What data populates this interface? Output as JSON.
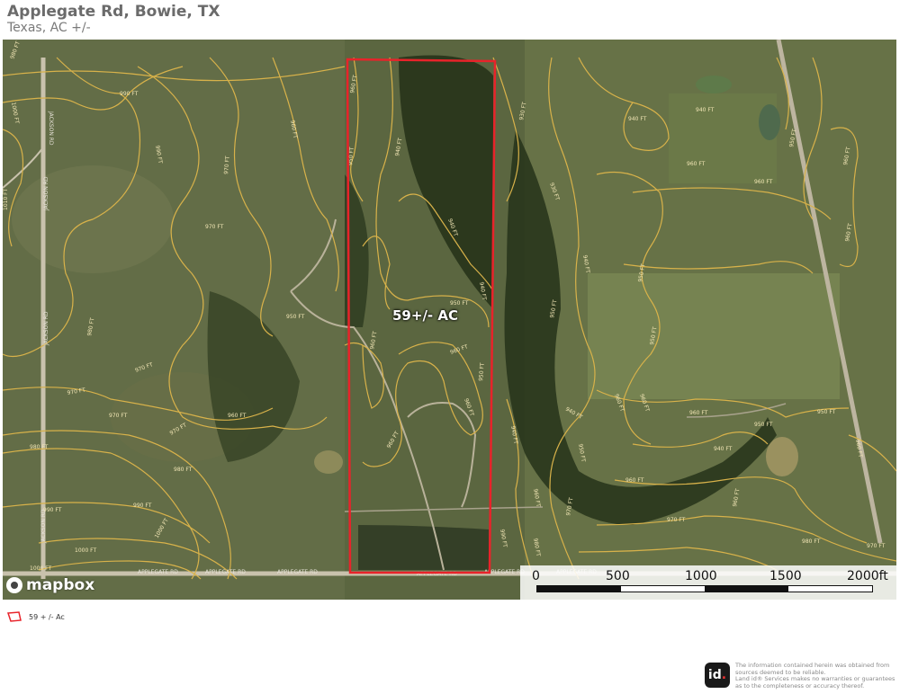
{
  "header": {
    "title": "Applegate Rd, Bowie, TX",
    "subtitle": "Texas,  AC +/-"
  },
  "map": {
    "parcel_label": "59+/- AC",
    "parcel_color": "#e8232a",
    "contour_color": "#d8b24a",
    "contour_labels": [
      "980 FT",
      "990 FT",
      "1000 FT",
      "1010 FT",
      "970 FT",
      "960 FT",
      "950 FT",
      "940 FT",
      "930 FT"
    ],
    "road_labels": [
      "JACKSON RD",
      "APPLEGATE RD"
    ],
    "attribution": "mapbox",
    "scale": {
      "ticks": [
        "0",
        "500",
        "1000",
        "1500",
        "2000ft"
      ]
    }
  },
  "legend": {
    "icon": "parcel-outline-icon",
    "label": "59 + /- Ac"
  },
  "footer": {
    "logo_text": "id",
    "logo_dot": ".",
    "disclaimer_1": "The information contained herein was obtained from",
    "disclaimer_2": "sources deemed to be reliable.",
    "disclaimer_3": "Land id® Services makes no warranties or guarantees",
    "disclaimer_4": "as to the completeness or accuracy thereof."
  }
}
